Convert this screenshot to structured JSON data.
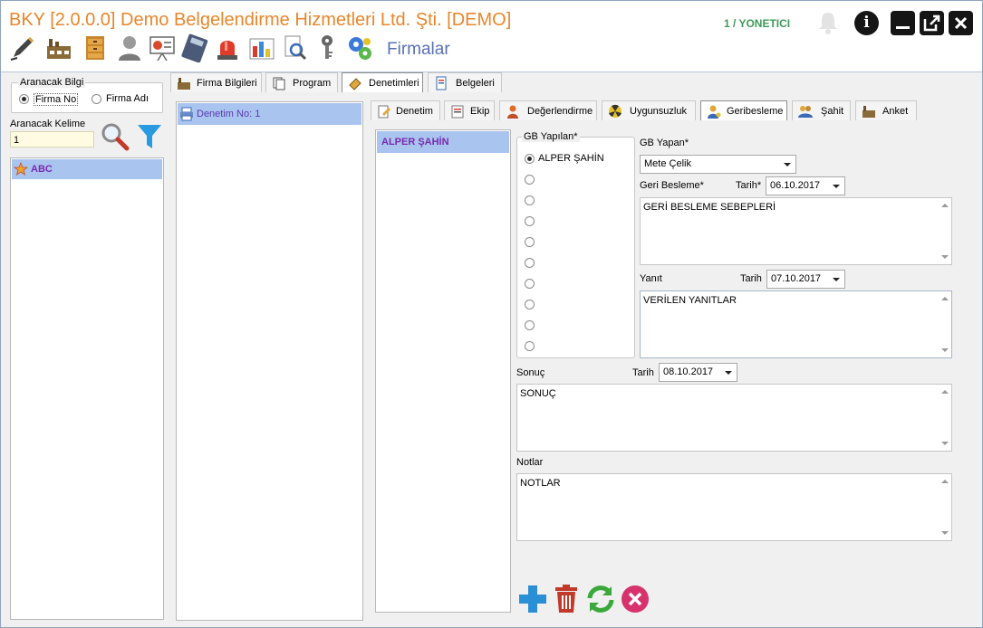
{
  "window": {
    "title": "BKY [2.0.0.0] Demo Belgelendirme Hizmetleri Ltd. Şti. [DEMO]",
    "user": "1 / YONETICI",
    "module_title": "Firmalar",
    "info_glyph": "i",
    "colors": {
      "title": "#e8862a",
      "user": "#3e9a5a",
      "module": "#5a6fb8",
      "selection": "#a9c4ee"
    }
  },
  "toolbar": {
    "icons": [
      "pen-icon",
      "factory-icon",
      "cabinet-icon",
      "user-icon",
      "presentation-icon",
      "calculator-icon",
      "alarm-light-icon",
      "bar-chart-icon",
      "document-search-icon",
      "key-icon",
      "settings-gears-icon"
    ]
  },
  "search": {
    "group_label": "Aranacak Bilgi",
    "option_firma_no": "Firma No",
    "option_firma_adi": "Firma Adı",
    "selected": "Firma No",
    "keyword_label": "Aranacak Kelime",
    "keyword_value": "1"
  },
  "companies": [
    {
      "name": "ABC"
    }
  ],
  "main_tabs": [
    {
      "label": "Firma Bilgileri"
    },
    {
      "label": "Program"
    },
    {
      "label": "Denetimleri"
    },
    {
      "label": "Belgeleri"
    }
  ],
  "audits": [
    {
      "label": "Denetim No: 1"
    }
  ],
  "sub_tabs": [
    {
      "label": "Denetim"
    },
    {
      "label": "Ekip"
    },
    {
      "label": "Değerlendirme"
    },
    {
      "label": "Uygunsuzluk"
    },
    {
      "label": "Geribesleme"
    },
    {
      "label": "Şahit"
    },
    {
      "label": "Anket"
    }
  ],
  "people": [
    {
      "name": "ALPER ŞAHİN"
    }
  ],
  "feedback": {
    "gb_yapilan_label": "GB Yapılan*",
    "gb_yapilan_options": [
      "ALPER ŞAHİN",
      "",
      "",
      "",
      "",
      "",
      "",
      "",
      "",
      ""
    ],
    "gb_yapan_label": "GB Yapan*",
    "gb_yapan_value": "Mete Çelik",
    "geri_besleme_label": "Geri Besleme*",
    "geri_besleme_date_label": "Tarih*",
    "geri_besleme_date": "06.10.2017",
    "geri_besleme_text": "GERİ BESLEME SEBEPLERİ",
    "yanit_label": "Yanıt",
    "yanit_date_label": "Tarih",
    "yanit_date": "07.10.2017",
    "yanit_text": "VERİLEN YANITLAR",
    "sonuc_label": "Sonuç",
    "sonuc_date_label": "Tarih",
    "sonuc_date": "08.10.2017",
    "sonuc_text": "SONUÇ",
    "notlar_label": "Notlar",
    "notlar_text": "NOTLAR"
  }
}
